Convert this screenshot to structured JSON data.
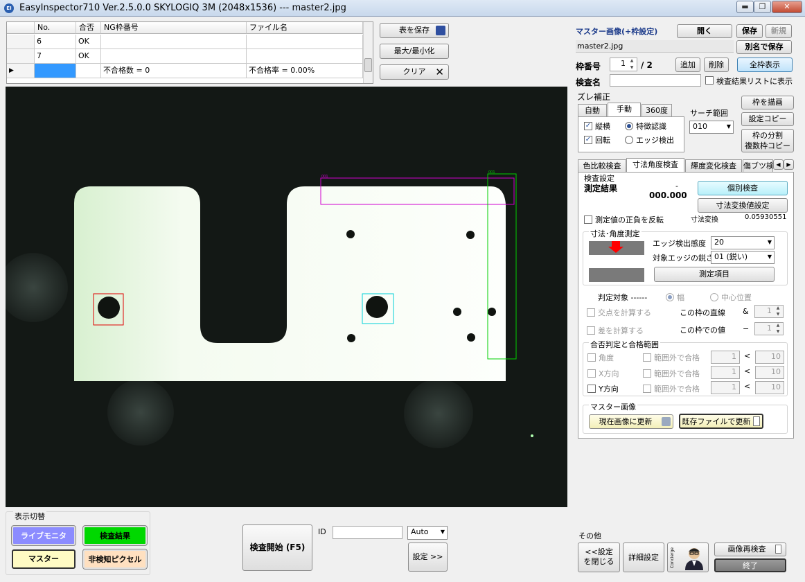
{
  "window": {
    "title": "EasyInspector710 Ver.2.5.0.0 SKYLOGIQ 3M    (2048x1536) --- master2.jpg",
    "app_icon": "EI",
    "buttons": {
      "minimize": "▬",
      "maximize": "❐",
      "close": "✕"
    }
  },
  "results_table": {
    "columns": [
      "No.",
      "合否",
      "NG枠番号",
      "ファイル名"
    ],
    "rows": [
      {
        "no": "6",
        "result": "OK",
        "ng": "",
        "file": ""
      },
      {
        "no": "7",
        "result": "OK",
        "ng": "",
        "file": ""
      },
      {
        "no": "",
        "result": "",
        "ng": "不合格数 = 0",
        "file": "不合格率 = 0.00%"
      }
    ]
  },
  "table_buttons": {
    "save_table": "表を保存",
    "minmax": "最大/最小化",
    "clear": "クリア"
  },
  "canvas": {
    "roi_label_1": "001",
    "roi_label_2": "001"
  },
  "master": {
    "title": "マスター画像(+枠設定)",
    "open": "開く",
    "save": "保存",
    "new": "新規",
    "filename": "master2.jpg",
    "save_as": "別名で保存",
    "frame_no_label": "枠番号",
    "frame_no": "1",
    "frame_total": "/ 2",
    "add": "追加",
    "delete": "削除",
    "show_all": "全枠表示",
    "inspect_name_label": "検査名",
    "show_in_results": "検査結果リストに表示"
  },
  "offset": {
    "title": "ズレ補正",
    "tabs": [
      "自動",
      "手動",
      "360度"
    ],
    "vertical_horizontal": "縦横",
    "rotation": "回転",
    "feature": "特徴認識",
    "edge": "エッジ検出",
    "search_range_label": "サーチ範囲",
    "search_range": "010",
    "draw_frame": "枠を描画",
    "copy_settings": "設定コピー",
    "split_1": "枠の分割",
    "split_2": "複数枠コピー"
  },
  "inspect_tabs": [
    "色比較検査",
    "寸法角度検査",
    "輝度変化検査",
    "傷ブツ検"
  ],
  "inspect": {
    "group": "検査設定",
    "result_label": "測定結果",
    "result_dash": "-",
    "result_value": "000.000",
    "individual": "個別検査",
    "dim_convert_setting": "寸法変換値設定",
    "invert_sign": "測定値の正負を反転",
    "dim_convert_label": "寸法変換",
    "dim_convert_value": "0.05930551",
    "measure_group": "寸法･角度測定",
    "edge_sens_label": "エッジ検出感度",
    "edge_sens": "20",
    "edge_sharp_label": "対象エッジの鋭さ",
    "edge_sharp": "01 (鋭い)",
    "measure_items": "測定項目",
    "judge_target": "判定対象 ------",
    "width": "幅",
    "center": "中心位置",
    "calc_intersection": "交点を計算する",
    "this_line": "この枠の直線",
    "amp": "&",
    "spin1": "1",
    "calc_diff": "差を計算する",
    "this_value": "この枠での値",
    "minus": "−",
    "spin2": "1",
    "pass_group": "合否判定と合格範囲",
    "angle": "角度",
    "x_dir": "X方向",
    "y_dir": "Y方向",
    "out_of_range": "範囲外で合格",
    "lt": "<",
    "min_val": "1",
    "max_val": "10",
    "master_group": "マスター画像",
    "update_current": "現在画像に更新",
    "update_file": "既存ファイルで更新"
  },
  "display": {
    "title": "表示切替",
    "live": "ライブモニタ",
    "result": "検査結果",
    "master": "マスター",
    "pixel": "非検知ピクセル"
  },
  "bottom": {
    "start": "検査開始 (F5)",
    "id_label": "ID",
    "auto": "Auto",
    "settings": "設定 >>"
  },
  "other": {
    "title": "その他",
    "close_settings_1": "<<設定",
    "close_settings_2": "を閉じる",
    "detail": "詳細設定",
    "concierge": "Concierge",
    "reinspect": "画像再検査",
    "exit": "終了"
  },
  "colors": {
    "live": "#8c8cff",
    "result": "#00d800",
    "master": "#fffbc4",
    "pixel": "#ffe0c0",
    "roi_red": "#e00000",
    "roi_cyan": "#00d0d8",
    "roi_magenta": "#d000d0",
    "roi_green": "#00d000"
  }
}
